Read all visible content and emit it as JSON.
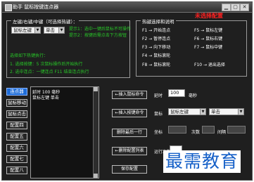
{
  "window": {
    "title": "助手 鼠标按键连点器",
    "buttons": {
      "minimize": "▁",
      "maximize": "▢",
      "close": "✕"
    }
  },
  "key_group": {
    "label": "左键/右键/中键（可选择热键）：",
    "button_combo": "鼠标左键",
    "click_combo": "单击",
    "hint1": "提示1：选中一键后鼠标不可操作",
    "hint2": "提示2：按键后需点击下方按钮",
    "hint3": "选择如下热键执行：",
    "hint4": "1. 选择按键：5 次鼠标操作后开始执行",
    "hint5": "2. 选中连点：一键连点 F11 结束连点执行"
  },
  "hotkey_group": {
    "label": "热键选择和说明",
    "rows": [
      [
        "F1 → 开始连点",
        "F5 → 鼠标左键"
      ],
      [
        "F2 → 暂停连点",
        "F6 → 鼠标右键"
      ],
      [
        "F3 → 向下移动",
        "F7 → 鼠标中键"
      ],
      [
        "F4 → 鼠标滚轮",
        ""
      ],
      [
        "F8 → 鼠标滚轮",
        "F10 → 退出选择"
      ]
    ]
  },
  "status": {
    "text": "未选择配置"
  },
  "preset_buttons": [
    "连点器",
    "鼠标移动",
    "鼠标点击",
    "配置四",
    "配置五",
    "配置六",
    "配置七",
    "配置八"
  ],
  "list_lines": [
    "延时 100 毫秒",
    "鼠标左键 单击"
  ],
  "action_buttons": [
    "←插入鼠标命令",
    "←插入按键命令",
    "删除最后一行",
    "←删除配置列表",
    "保存配置"
  ],
  "form": {
    "delay_label": "延时",
    "delay_value": "100",
    "delay_unit": "毫秒",
    "mouse_label": "鼠标",
    "mouse_button_value": "鼠标左键",
    "mouse_click_value": "单击",
    "coord_label": "坐标",
    "repeat_label": "次数",
    "interval_label": "间隔",
    "times_label": "运行次数"
  },
  "watermark": {
    "text": "最需教育"
  }
}
